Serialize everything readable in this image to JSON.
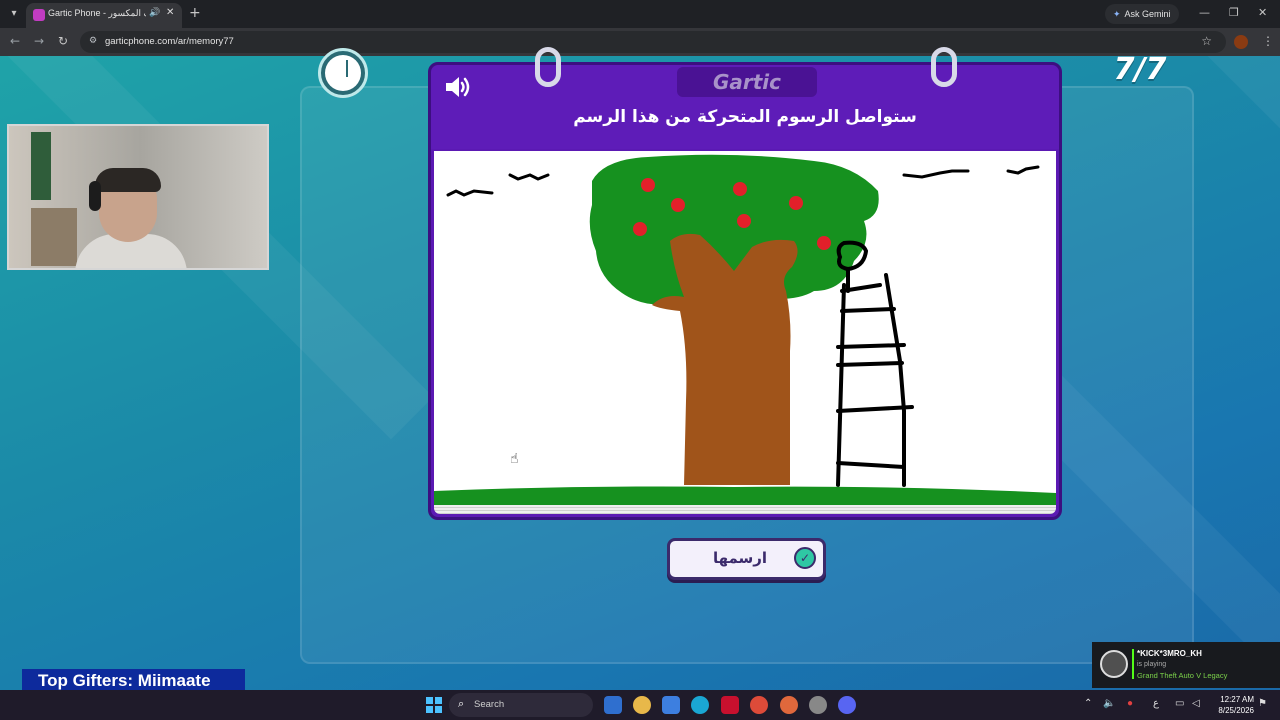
{
  "browser": {
    "tab_title": "Gartic Phone - هاتف المكسور",
    "url": "garticphone.com/ar/memory77",
    "gemini_label": "Ask Gemini"
  },
  "game": {
    "logo": "Gartic",
    "round_counter": "7/7",
    "prompt": "ستواصل الرسوم المتحركة من هذا الرسم",
    "done_button_label": "ارسمها",
    "accent_purple": "#5b19b3",
    "accent_teal": "#2fc7a4"
  },
  "overlay": {
    "top_gifters": "Top Gifters: Miimaate"
  },
  "notification": {
    "user": "*KICK*3MRO_KH",
    "status": "is playing",
    "game": "Grand Theft Auto V Legacy"
  },
  "taskbar": {
    "search_placeholder": "Search",
    "input_lang": "ع",
    "time": "12:27 AM",
    "date": "8/25/2026"
  }
}
